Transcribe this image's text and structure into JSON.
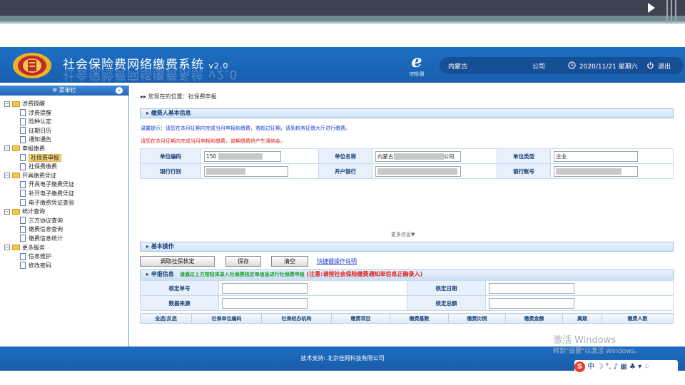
{
  "app": {
    "title": "社会保险费网络缴费系统",
    "version": "v2.0",
    "ie_check_label": "IE检测",
    "region": "内蒙古",
    "company": "公司",
    "datetime": "2020/11/21 星期六",
    "logout": "退出"
  },
  "sidebar": {
    "header": "菜单栏",
    "groups": [
      {
        "label": "涉费提醒",
        "items": [
          "涉费提醒",
          "险种认定",
          "征期日历",
          "通知通告"
        ]
      },
      {
        "label": "申报缴费",
        "items": [
          "社保费申报",
          "社保费缴费"
        ]
      },
      {
        "label": "开具缴费凭证",
        "items": [
          "开具电子缴费凭证",
          "补开电子缴费凭证",
          "电子缴费凭证查验"
        ]
      },
      {
        "label": "统计查询",
        "items": [
          "三方协议查询",
          "缴费信息查询",
          "缴费信息统计"
        ]
      },
      {
        "label": "更多服务",
        "items": [
          "信息维护",
          "修改密码"
        ]
      }
    ],
    "selected": "社保费申报"
  },
  "breadcrumb": "您现在的位置：社保费申报",
  "payer": {
    "header": "缴费人基本信息",
    "notice1": "温馨提示：请您在本月征期内完成当月申报和缴费，若超过征期，请到税务征缴大厅进行缴费。",
    "notice2": "请您在本月征期内完成当月申报和缴费，逾期缴费将产生滞纳金。",
    "unit_code_label": "单位编码",
    "unit_code_value": "150",
    "unit_name_label": "单位名称",
    "unit_name_prefix": "内蒙古",
    "unit_name_suffix": "公司",
    "unit_type_label": "单位类型",
    "unit_type_value": "企业",
    "bank_type_label": "银行行别",
    "bank_open_label": "开户银行",
    "bank_account_label": "银行账号",
    "more": "更多信息▼"
  },
  "ops": {
    "header": "基本操作",
    "fetch_button": "调取社保核定",
    "save_button": "保存",
    "clear_button": "清空",
    "shortcut_link": "快捷键操作说明"
  },
  "declare": {
    "header": "申报信息",
    "hint_green": "请通过上方按钮来录入社保费核定单信息进行社保费申报",
    "hint_red": "(注意:请按社会保险缴费通知单信息正确录入)",
    "check_no_label": "核定单号",
    "check_date_label": "核定日期",
    "data_source_label": "数据来源",
    "check_total_label": "核定总额",
    "columns": [
      "全选|反选",
      "社保单位编码",
      "社保经办机构",
      "缴费项目",
      "缴费基数",
      "缴费比例",
      "缴费金额",
      "属期",
      "缴费人数"
    ]
  },
  "footer": "技术支持: 北京佳网科技有限公司",
  "watermark": {
    "line1": "激活 Windows",
    "line2": "转到\"设置\"以激活 Windows。"
  },
  "ime": {
    "label": "中"
  }
}
